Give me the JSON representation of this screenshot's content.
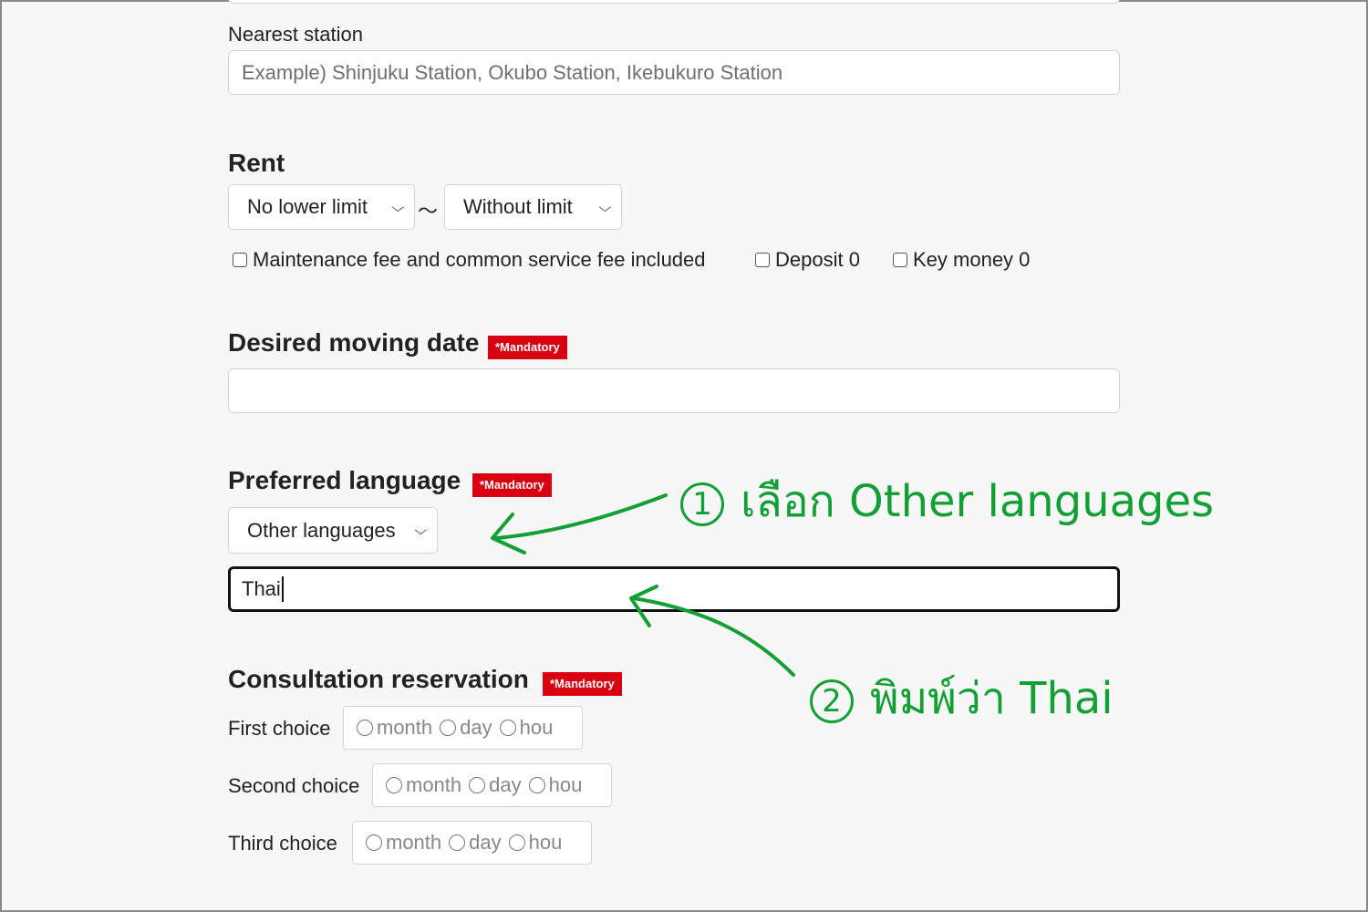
{
  "station": {
    "label": "Nearest station",
    "placeholder": "Example) Shinjuku Station, Okubo Station, Ikebukuro Station"
  },
  "rent": {
    "heading": "Rent",
    "min_value": "No lower limit",
    "separator": "～",
    "max_value": "Without limit",
    "options": [
      {
        "label": "Maintenance fee and common service fee included",
        "checked": false
      },
      {
        "label": "Deposit 0",
        "checked": false
      },
      {
        "label": "Key money 0",
        "checked": false
      }
    ]
  },
  "moving_date": {
    "heading": "Desired moving date",
    "badge": "*Mandatory",
    "value": ""
  },
  "language": {
    "heading": "Preferred language",
    "badge": "*Mandatory",
    "select_value": "Other languages",
    "text_value": "Thai"
  },
  "consultation": {
    "heading": "Consultation reservation",
    "badge": "*Mandatory",
    "choices": [
      {
        "label": "First choice",
        "month": "month",
        "day": "day",
        "hour": "hou"
      },
      {
        "label": "Second choice",
        "month": "month",
        "day": "day",
        "hour": "hou"
      },
      {
        "label": "Third choice",
        "month": "month",
        "day": "day",
        "hour": "hou"
      }
    ]
  },
  "annotations": {
    "step1_number": "1",
    "step1_text": "เลือก Other languages",
    "step2_number": "2",
    "step2_text": "พิมพ์ว่า Thai",
    "color": "#12a035"
  }
}
